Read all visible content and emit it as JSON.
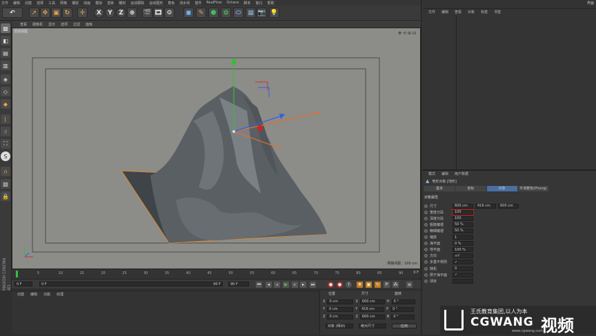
{
  "menubar": {
    "items": [
      "文件",
      "编辑",
      "创建",
      "选择",
      "工具",
      "网格",
      "捕捉",
      "动画",
      "模拟",
      "渲染",
      "雕刻",
      "运动跟踪",
      "运动图形",
      "角色",
      "流水线",
      "插件",
      "RealFlow",
      "Octane",
      "脚本",
      "窗口",
      "帮助"
    ]
  },
  "right_top": {
    "tabs": [
      "文件",
      "编辑",
      "查看",
      "对象",
      "标签",
      "书签"
    ],
    "layout_label": "界面"
  },
  "viewport": {
    "menu": [
      "查看",
      "摄像机",
      "显示",
      "选项",
      "过滤",
      "面板"
    ],
    "title": "透视视图",
    "grid_label": "网格间距 : 100 cm"
  },
  "timeline": {
    "ticks": [
      "0",
      "5",
      "10",
      "15",
      "20",
      "25",
      "30",
      "35",
      "40",
      "45",
      "50",
      "55",
      "60",
      "65",
      "70",
      "75",
      "80",
      "85",
      "90"
    ],
    "end_label": "0 F"
  },
  "transport": {
    "current_frame": "0 F",
    "start_field": "0 F",
    "end_field": "90 F",
    "max_field": "90 F"
  },
  "material_panel": {
    "tabs": [
      "创建",
      "编辑",
      "功能",
      "纹理"
    ]
  },
  "coord_panel": {
    "headers": [
      "位置",
      "尺寸",
      "旋转"
    ],
    "rows": [
      {
        "axis": "X",
        "pos": "0 cm",
        "size": "600 cm",
        "rot_axis": "H",
        "rot": "0 °"
      },
      {
        "axis": "Y",
        "pos": "0 cm",
        "size": "416 cm",
        "rot_axis": "P",
        "rot": "0 °"
      },
      {
        "axis": "Z",
        "pos": "0 cm",
        "size": "600 cm",
        "rot_axis": "B",
        "rot": "0 °"
      }
    ],
    "mode_select": "对象 (相对)",
    "size_select": "绝对尺寸",
    "apply_button": "应用"
  },
  "attr": {
    "tabs": [
      "模式",
      "编辑",
      "用户数据"
    ],
    "object_title": "地形对象 [地形]",
    "subtabs": [
      "基本",
      "坐标",
      "对象",
      "平滑着色(Phong)"
    ],
    "active_subtab": 2,
    "section": "对象属性",
    "props": [
      {
        "label": "尺寸",
        "values": [
          "600 cm",
          "416 cm",
          "600 cm"
        ]
      },
      {
        "label": "宽度分段",
        "values": [
          "100"
        ]
      },
      {
        "label": "深度分段",
        "values": [
          "100"
        ]
      },
      {
        "label": "粗糙皱褶",
        "values": [
          "50 %"
        ]
      },
      {
        "label": "精细皱褶",
        "values": [
          "50 %"
        ]
      },
      {
        "label": "缩放",
        "values": [
          "1"
        ]
      },
      {
        "label": "海平面",
        "values": [
          "0 %"
        ]
      },
      {
        "label": "地平面",
        "values": [
          "100 %"
        ]
      },
      {
        "label": "方向",
        "values": [
          "+Y"
        ]
      },
      {
        "label": "多重不规则",
        "values": [
          "✓"
        ]
      },
      {
        "label": "随机",
        "values": [
          "0"
        ]
      },
      {
        "label": "限于海平面",
        "values": [
          "✓"
        ]
      },
      {
        "label": "球状",
        "values": [
          ""
        ]
      }
    ]
  },
  "brand": {
    "line1": "王氏教育集团,以人为本",
    "name": "CGWANG",
    "suffix": "视频",
    "url": "www.cgwang.com",
    "vertical": "MAXON CINEMA 4D"
  },
  "colors": {
    "viewport_bg": "#8c8c89",
    "accent": "#e0a040",
    "active_tab": "#4a6fa0"
  }
}
